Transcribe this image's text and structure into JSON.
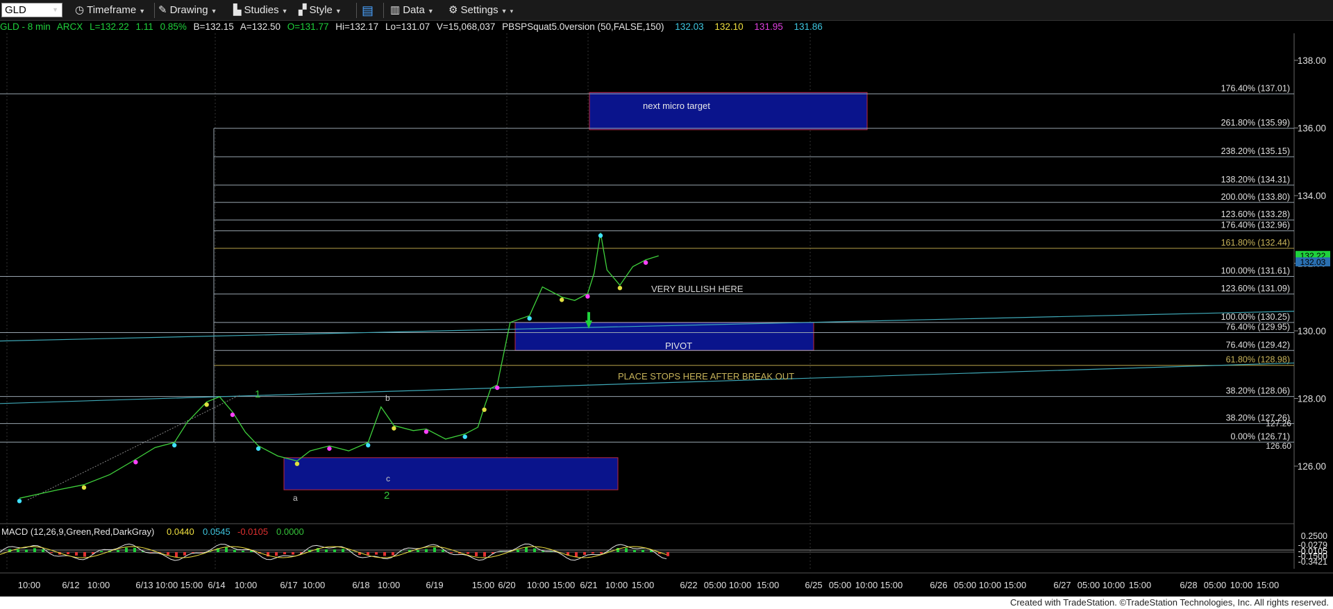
{
  "toolbar": {
    "symbol": "GLD",
    "timeframe": "Timeframe",
    "drawing": "Drawing",
    "studies": "Studies",
    "style": "Style",
    "data": "Data",
    "settings": "Settings"
  },
  "info": {
    "symbol_interval": "GLD - 8 min",
    "exchange": "ARCX",
    "last": "L=132.22",
    "change": "1.11",
    "change_pct": "0.85%",
    "bid": "B=132.15",
    "ask": "A=132.50",
    "open": "O=131.77",
    "high": "Hi=132.17",
    "low": "Lo=131.07",
    "volume": "V=15,068,037",
    "study": "PBSPSquat5.0version (50,FALSE,150)",
    "study_v1": "132.03",
    "study_v2": "132.10",
    "study_v3": "131.95",
    "study_v4": "131.86"
  },
  "macd": {
    "label": "MACD (12,26,9,Green,Red,DarkGray)",
    "v1": "0.0440",
    "v2": "0.0545",
    "v3": "-0.0105",
    "v4": "0.0000"
  },
  "footer": "Created with TradeStation. ©TradeStation Technologies, Inc. All rights reserved.",
  "colors": {
    "background": "#000000",
    "fib_line": "#9aa6b0",
    "zone_fill": "#0a148c",
    "zone_border": "#c0283c",
    "trend_line": "#3fa9b8",
    "stop_line": "#b8a24a",
    "label_green": "#35c43a",
    "price_tag": "#1fd13c"
  },
  "chart_data": {
    "type": "line",
    "title": "",
    "y_axis": {
      "ylim": [
        124.4,
        138.8
      ],
      "ticks": [
        "138.00",
        "136.00",
        "134.00",
        "132.00",
        "130.00",
        "128.00",
        "126.00"
      ]
    },
    "x_axis": {
      "tick_labels": [
        "10:00",
        "6/12",
        "10:00",
        "6/13",
        "10:00",
        "15:00",
        "6/14",
        "10:00",
        "6/17",
        "10:00",
        "6/18",
        "10:00",
        "6/19",
        "15:00",
        "6/20",
        "10:00",
        "15:00",
        "6/21",
        "10:00",
        "15:00",
        "6/22",
        "05:00",
        "10:00",
        "15:00",
        "6/25",
        "05:00",
        "10:00",
        "15:00",
        "6/26",
        "05:00",
        "10:00",
        "15:00",
        "6/27",
        "05:00",
        "10:00",
        "15:00",
        "6/28",
        "05:00",
        "10:00",
        "15:00"
      ]
    },
    "fib_levels": [
      {
        "label": "176.40% (137.01)",
        "price": 137.01
      },
      {
        "label": "261.80% (135.99)",
        "price": 135.99
      },
      {
        "label": "238.20% (135.15)",
        "price": 135.15
      },
      {
        "label": "138.20% (134.31)",
        "price": 134.31
      },
      {
        "label": "200.00% (133.80)",
        "price": 133.8
      },
      {
        "label": "123.60% (133.28)",
        "price": 133.28
      },
      {
        "label": "176.40% (132.96)",
        "price": 132.96
      },
      {
        "label": "161.80% (132.44)",
        "price": 132.44
      },
      {
        "label": "100.00% (131.61)",
        "price": 131.61
      },
      {
        "label": "123.60% (131.09)",
        "price": 131.09
      },
      {
        "label": "100.00% (130.25)",
        "price": 130.25
      },
      {
        "label": "76.40% (129.95)",
        "price": 129.95
      },
      {
        "label": "76.40% (129.42)",
        "price": 129.42
      },
      {
        "label": "61.80% (128.98)",
        "price": 128.98
      },
      {
        "label": "38.20% (128.06)",
        "price": 128.06
      },
      {
        "label": "38.20% (127.26)",
        "price": 127.26
      },
      {
        "label": "0.00% (126.71)",
        "price": 126.71
      }
    ],
    "price_tags": [
      "132.22",
      "132.03"
    ],
    "axis_tags": [
      "127.26",
      "126.60"
    ],
    "zones": [
      {
        "label": "next micro target",
        "low": 135.95,
        "high": 137.05
      },
      {
        "label": "PIVOT",
        "low": 129.42,
        "high": 130.25
      },
      {
        "label": "",
        "low": 125.3,
        "high": 126.25
      }
    ],
    "annotations": [
      "VERY BULLISH HERE",
      "PLACE STOPS HERE AFTER BREAK OUT"
    ],
    "wave_labels": [
      "1",
      "b",
      "c",
      "a",
      "2"
    ],
    "price_path": [
      [
        0,
        125.05
      ],
      [
        6,
        125.3
      ],
      [
        10,
        125.45
      ],
      [
        14,
        125.75
      ],
      [
        18,
        126.2
      ],
      [
        21,
        126.55
      ],
      [
        24,
        126.7
      ],
      [
        26,
        127.3
      ],
      [
        29,
        127.9
      ],
      [
        31,
        128.05
      ],
      [
        33,
        127.6
      ],
      [
        35,
        127.0
      ],
      [
        37,
        126.6
      ],
      [
        40,
        126.3
      ],
      [
        43,
        126.15
      ],
      [
        45,
        126.45
      ],
      [
        48,
        126.6
      ],
      [
        51,
        126.45
      ],
      [
        54,
        126.7
      ],
      [
        56,
        127.75
      ],
      [
        58,
        127.2
      ],
      [
        61,
        127.05
      ],
      [
        63,
        127.1
      ],
      [
        66,
        126.8
      ],
      [
        69,
        126.95
      ],
      [
        71,
        127.15
      ],
      [
        72,
        127.75
      ],
      [
        73,
        128.3
      ],
      [
        74,
        128.4
      ],
      [
        76,
        130.25
      ],
      [
        79,
        130.45
      ],
      [
        81,
        131.3
      ],
      [
        84,
        131.0
      ],
      [
        86,
        130.9
      ],
      [
        88,
        131.1
      ],
      [
        89,
        131.7
      ],
      [
        90,
        132.9
      ],
      [
        91,
        131.8
      ],
      [
        93,
        131.35
      ],
      [
        95,
        131.9
      ],
      [
        97,
        132.1
      ],
      [
        99,
        132.22
      ]
    ],
    "macd_axis": {
      "ticks": [
        "0.2500",
        "-0.0279",
        "-0.0105",
        "-0.1500",
        "-0.3421"
      ]
    }
  }
}
